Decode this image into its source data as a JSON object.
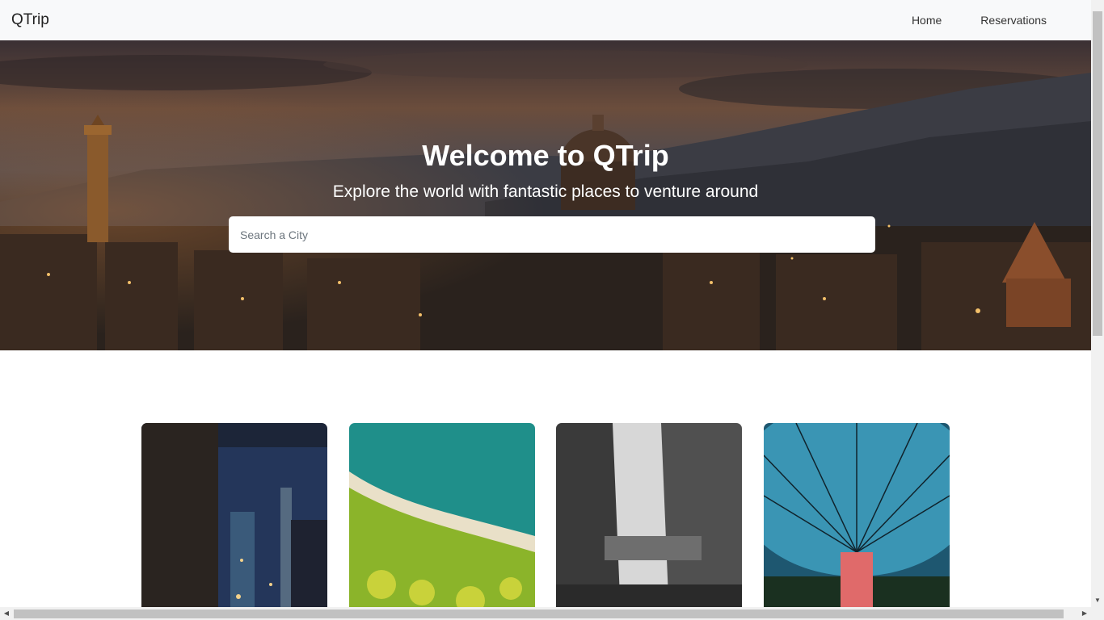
{
  "navbar": {
    "brand": "QTrip",
    "links": [
      {
        "label": "Home"
      },
      {
        "label": "Reservations"
      }
    ]
  },
  "hero": {
    "title": "Welcome to QTrip",
    "subtitle": "Explore the world with fantastic places to venture around",
    "search_placeholder": "Search a City"
  },
  "cards": [
    {
      "image": "night-city-street"
    },
    {
      "image": "aerial-beach-coast"
    },
    {
      "image": "skybridge-towers"
    },
    {
      "image": "glass-dome-waterfall"
    }
  ],
  "colors": {
    "navbar_bg": "#f8f9fa",
    "hero_text": "#ffffff",
    "accent": "#1a73e8"
  }
}
